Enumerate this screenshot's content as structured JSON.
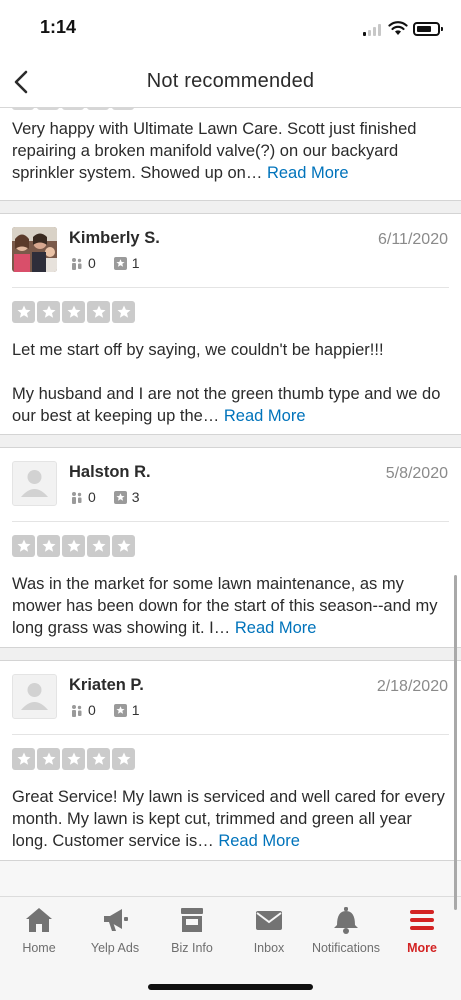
{
  "status_bar": {
    "time": "1:14"
  },
  "nav": {
    "title": "Not recommended"
  },
  "first_review": {
    "text": "Very happy with Ultimate Lawn Care. Scott just finished repairing a broken manifold valve(?) on our backyard sprinkler system. Showed up on… ",
    "read_more": "Read More"
  },
  "reviews": [
    {
      "name": "Kimberly S.",
      "date": "6/11/2020",
      "friends": "0",
      "reviews": "1",
      "rating": 5,
      "text": "Let me start off by saying, we couldn't be happier!!!\n\nMy husband and I are not the green thumb type and we do our best at keeping up the… ",
      "read_more": "Read More"
    },
    {
      "name": "Halston R.",
      "date": "5/8/2020",
      "friends": "0",
      "reviews": "3",
      "rating": 5,
      "text": "Was in the market for some lawn maintenance, as my mower has been down for the start of this season--and my long grass was showing it. I… ",
      "read_more": "Read More"
    },
    {
      "name": "Kriaten P.",
      "date": "2/18/2020",
      "friends": "0",
      "reviews": "1",
      "rating": 5,
      "text": "Great Service! My lawn is serviced and well cared for every month. My lawn is kept cut, trimmed and green all year long. Customer service is… ",
      "read_more": "Read More"
    }
  ],
  "tabs": [
    {
      "label": "Home",
      "icon": "home-icon"
    },
    {
      "label": "Yelp Ads",
      "icon": "megaphone-icon"
    },
    {
      "label": "Biz Info",
      "icon": "storefront-icon"
    },
    {
      "label": "Inbox",
      "icon": "envelope-icon"
    },
    {
      "label": "Notifications",
      "icon": "bell-icon"
    },
    {
      "label": "More",
      "icon": "menu-icon",
      "active": true
    }
  ],
  "colors": {
    "link": "#0073bb",
    "active_tab": "#d32323",
    "star_inactive": "#cbcbcb",
    "tab_icon": "#737373"
  }
}
